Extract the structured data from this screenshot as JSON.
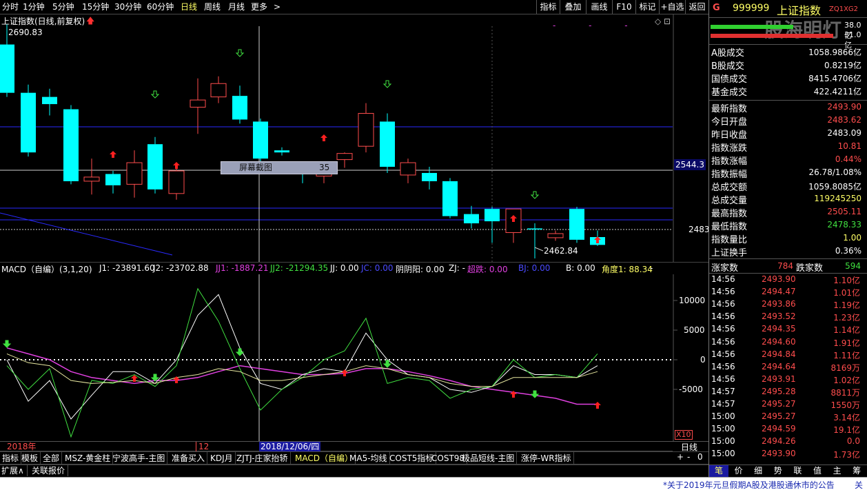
{
  "toolbar": {
    "periods": [
      "分时",
      "1分钟",
      "5分钟",
      "15分钟",
      "30分钟",
      "60分钟",
      "日线",
      "周线",
      "月线",
      "更多"
    ],
    "active_period": "日线",
    "more_arrow": ">",
    "right_buttons": [
      "指标",
      "叠加",
      "画线",
      "F10",
      "标记",
      "+自选",
      "返回"
    ]
  },
  "main_chart": {
    "title": "上证指数(日线,前复权)",
    "high_label": "2690.83",
    "low_label": "2462.84",
    "price_tag": "2544.3",
    "level_label": "2483",
    "tooltip_text": "屏幕截图",
    "tooltip_num": "35",
    "corner_icons": "◇ ⊡"
  },
  "macd": {
    "title": "MACD（自编）(3,1,20)",
    "readouts": [
      {
        "text": "J1: -23891.60",
        "color": "#ffffff"
      },
      {
        "text": "J2: -23702.88",
        "color": "#ffffff"
      },
      {
        "text": "JJ1: -1887.21",
        "color": "#e040e0"
      },
      {
        "text": "JJ2: -21294.35",
        "color": "#40e040"
      },
      {
        "text": "JJ: 0.00",
        "color": "#ffffff"
      },
      {
        "text": "JC: 0.00",
        "color": "#4a4aff"
      },
      {
        "text": "阴阴阳: 0.00",
        "color": "#ffffff"
      },
      {
        "text": "ZJ: -",
        "color": "#ffffff"
      },
      {
        "text": "超跌: 0.00",
        "color": "#e040e0"
      },
      {
        "text": "BJ: 0.00",
        "color": "#4a4aff"
      },
      {
        "text": "B: 0.00",
        "color": "#ffffff"
      },
      {
        "text": "角度1: 88.34",
        "color": "#ffff66"
      },
      {
        "text": "-",
        "color": "#ffffff"
      }
    ],
    "y_labels": [
      "10000",
      "5000",
      "0",
      "-5000"
    ],
    "x10": "X10"
  },
  "timeline": {
    "year": "2018年",
    "month": "12",
    "cursor_date": "2018/12/06/四",
    "period": "日线",
    "zoom_buttons": [
      "+",
      "-",
      "0"
    ]
  },
  "bottom_tabs": [
    "指标",
    "模板",
    "全部",
    "MSZ-黄金柱",
    "宁波高手-主图",
    "准备买入",
    "KDJ月",
    "ZJTJ-庄家抬轿",
    "MACD（自编）",
    "MA5-均线",
    "COST5指标",
    "COST98",
    "极品短线-主图",
    "涨停-WR指标"
  ],
  "active_tab": "MACD（自编）",
  "status_tabs": [
    "扩展∧",
    "关联报价"
  ],
  "quote": {
    "g": "G",
    "code": "999999",
    "name": "上证指数",
    "flag": "ZQ1XG2",
    "watermark": "股海明灯",
    "bar1_val": "38.0亿",
    "bar2_val": "31.0亿",
    "rows1": [
      {
        "label": "A股成交",
        "value": "1058.9866亿",
        "color": "#ffffff"
      },
      {
        "label": "B股成交",
        "value": "0.8219亿",
        "color": "#ffffff"
      },
      {
        "label": "国债成交",
        "value": "8415.4706亿",
        "color": "#ffffff"
      },
      {
        "label": "基金成交",
        "value": "422.4211亿",
        "color": "#ffffff"
      }
    ],
    "rows2": [
      {
        "label": "最新指数",
        "value": "2493.90",
        "color": "#ff4d4d"
      },
      {
        "label": "今日开盘",
        "value": "2483.62",
        "color": "#ff4d4d"
      },
      {
        "label": "昨日收盘",
        "value": "2483.09",
        "color": "#ffffff"
      },
      {
        "label": "指数涨跌",
        "value": "10.81",
        "color": "#ff4d4d"
      },
      {
        "label": "指数涨幅",
        "value": "0.44%",
        "color": "#ff4d4d"
      },
      {
        "label": "指数振幅",
        "value": "26.78/1.08%",
        "color": "#ffffff"
      },
      {
        "label": "总成交额",
        "value": "1059.8085亿",
        "color": "#ffffff"
      },
      {
        "label": "总成交量",
        "value": "119245250",
        "color": "#ffff66"
      },
      {
        "label": "最高指数",
        "value": "2505.11",
        "color": "#ff4d4d"
      },
      {
        "label": "最低指数",
        "value": "2478.33",
        "color": "#40e040"
      },
      {
        "label": "指数量比",
        "value": "1.00",
        "color": "#ffff66"
      },
      {
        "label": "上证换手",
        "value": "0.36%",
        "color": "#ffffff"
      }
    ],
    "up_label": "涨家数",
    "up_count": "784",
    "down_label": "跌家数",
    "down_count": "594",
    "ticks": [
      {
        "time": "14:56",
        "price": "2493.90",
        "amount": "1.10亿"
      },
      {
        "time": "14:56",
        "price": "2494.47",
        "amount": "1.01亿"
      },
      {
        "time": "14:56",
        "price": "2493.86",
        "amount": "1.19亿"
      },
      {
        "time": "14:56",
        "price": "2493.52",
        "amount": "1.23亿"
      },
      {
        "time": "14:56",
        "price": "2494.35",
        "amount": "1.14亿"
      },
      {
        "time": "14:56",
        "price": "2494.60",
        "amount": "1.91亿"
      },
      {
        "time": "14:56",
        "price": "2494.84",
        "amount": "1.11亿"
      },
      {
        "time": "14:56",
        "price": "2494.64",
        "amount": "8169万"
      },
      {
        "time": "14:56",
        "price": "2493.91",
        "amount": "1.02亿"
      },
      {
        "time": "14:57",
        "price": "2495.28",
        "amount": "8811万"
      },
      {
        "time": "14:57",
        "price": "2495.27",
        "amount": "1550万"
      },
      {
        "time": "15:00",
        "price": "2495.27",
        "amount": "3.14亿"
      },
      {
        "time": "15:00",
        "price": "2494.59",
        "amount": "19.1亿"
      },
      {
        "time": "15:00",
        "price": "2494.26",
        "amount": "0.0"
      },
      {
        "time": "15:00",
        "price": "2493.90",
        "amount": "1.73亿"
      }
    ],
    "bottom_tabs": [
      "笔",
      "价",
      "细",
      "势",
      "联",
      "值",
      "主",
      "筹"
    ]
  },
  "news": "*关于2019年元旦假期A股及港股通休市的公告",
  "news_tail": "关",
  "colors": {
    "up": "#ff4d4d",
    "down": "#00ffff",
    "green": "#40e040",
    "magenta": "#e040e0",
    "blue": "#2a2aff",
    "white": "#ffffff"
  },
  "candles": [
    {
      "o": 2671,
      "h": 2690.83,
      "l": 2620,
      "c": 2624
    },
    {
      "o": 2624,
      "h": 2632,
      "l": 2562,
      "c": 2566
    },
    {
      "o": 2620,
      "h": 2628,
      "l": 2602,
      "c": 2613
    },
    {
      "o": 2608,
      "h": 2612,
      "l": 2535,
      "c": 2538
    },
    {
      "o": 2538,
      "h": 2560,
      "l": 2525,
      "c": 2542
    },
    {
      "o": 2545,
      "h": 2548,
      "l": 2526,
      "c": 2534
    },
    {
      "o": 2535,
      "h": 2568,
      "l": 2522,
      "c": 2556
    },
    {
      "o": 2574,
      "h": 2581,
      "l": 2526,
      "c": 2530
    },
    {
      "o": 2526,
      "h": 2550,
      "l": 2520,
      "c": 2548
    },
    {
      "o": 2610,
      "h": 2638,
      "l": 2584,
      "c": 2617
    },
    {
      "o": 2620,
      "h": 2640,
      "l": 2614,
      "c": 2633
    },
    {
      "o": 2621,
      "h": 2631,
      "l": 2594,
      "c": 2598
    },
    {
      "o": 2596,
      "h": 2599,
      "l": 2557,
      "c": 2560
    },
    {
      "o": 2568,
      "h": 2571,
      "l": 2563,
      "c": 2566
    },
    {
      "o": 2551,
      "h": 2557,
      "l": 2536,
      "c": 2546
    },
    {
      "o": 2543,
      "h": 2552,
      "l": 2536,
      "c": 2552
    },
    {
      "o": 2559,
      "h": 2566,
      "l": 2551,
      "c": 2565
    },
    {
      "o": 2572,
      "h": 2614,
      "l": 2566,
      "c": 2604
    },
    {
      "o": 2596,
      "h": 2604,
      "l": 2546,
      "c": 2552
    },
    {
      "o": 2544,
      "h": 2560,
      "l": 2536,
      "c": 2556
    },
    {
      "o": 2546,
      "h": 2552,
      "l": 2530,
      "c": 2538
    },
    {
      "o": 2538,
      "h": 2541,
      "l": 2502,
      "c": 2504
    },
    {
      "o": 2506,
      "h": 2514,
      "l": 2492,
      "c": 2497
    },
    {
      "o": 2511,
      "h": 2513,
      "l": 2478,
      "c": 2499
    },
    {
      "o": 2488,
      "h": 2511,
      "l": 2478,
      "c": 2511
    },
    {
      "o": 2492,
      "h": 2497,
      "l": 2462.84,
      "c": 2491
    },
    {
      "o": 2483,
      "h": 2490,
      "l": 2480,
      "c": 2487
    },
    {
      "o": 2511,
      "h": 2513,
      "l": 2478,
      "c": 2481
    },
    {
      "o": 2483.62,
      "h": 2490,
      "l": 2475,
      "c": 2476
    }
  ]
}
